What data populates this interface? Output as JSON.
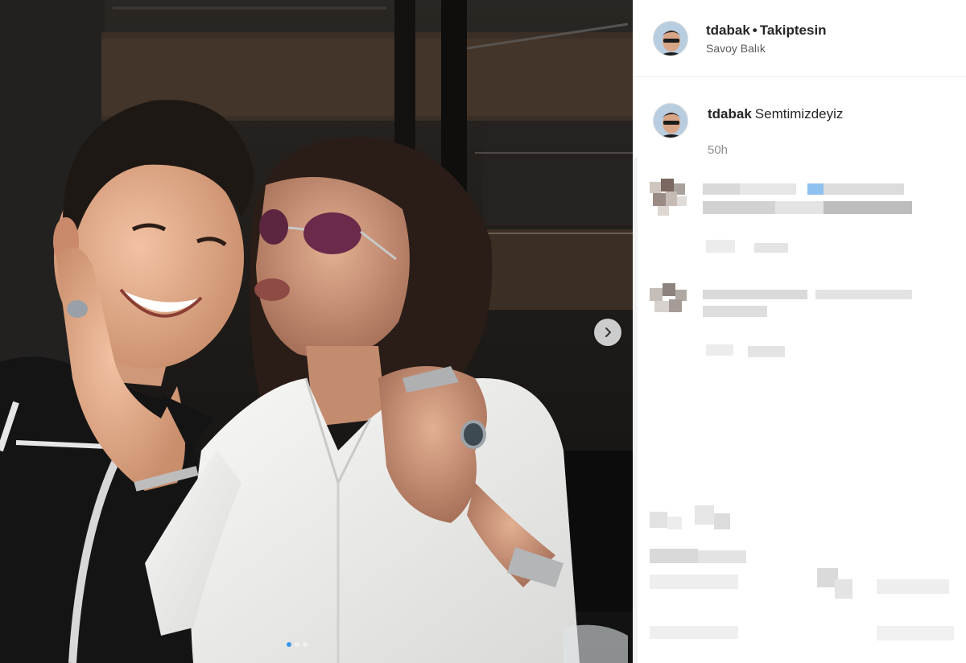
{
  "post": {
    "username": "tdabak",
    "separator": "•",
    "follow_status": "Takiptesin",
    "location": "Savoy Balık",
    "caption_text": "Semtimizdeyiz",
    "time_ago": "50h",
    "carousel": {
      "slides": 3,
      "active_index": 0
    }
  },
  "colors": {
    "accent": "#3897f0",
    "border": "#efefef",
    "muted_text": "#8e8e8e"
  },
  "icons": {
    "next": "chevron-right-icon",
    "avatar": "profile-avatar"
  }
}
